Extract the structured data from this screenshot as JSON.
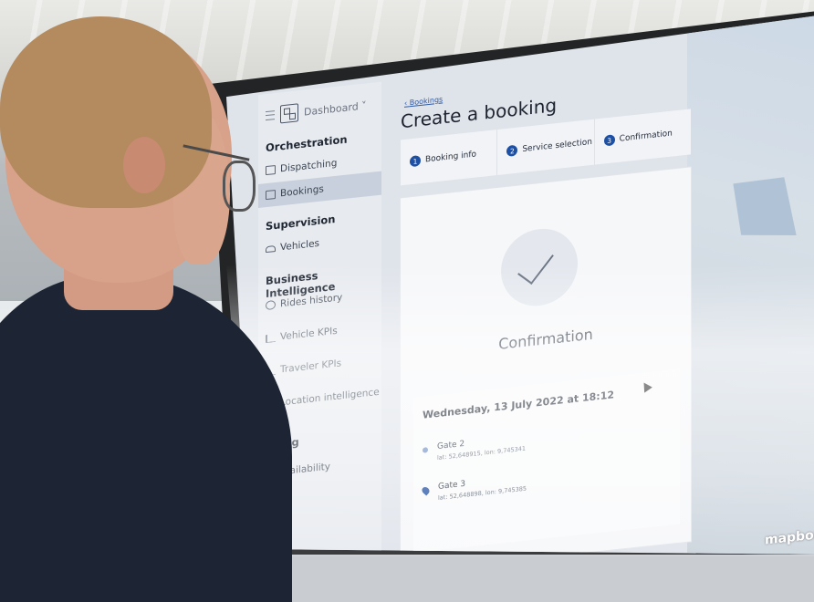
{
  "app": {
    "header": {
      "dashboard_label": "Dashboard ˅"
    },
    "sidebar": {
      "sections": [
        {
          "label": "Orchestration"
        },
        {
          "label": "Supervision"
        },
        {
          "label": "Business Intelligence"
        },
        {
          "label": "nning"
        }
      ],
      "items": [
        {
          "label": "Dispatching",
          "icon": "calendar-icon"
        },
        {
          "label": "Bookings",
          "icon": "booking-icon",
          "active": true
        },
        {
          "label": "Vehicles",
          "icon": "car-icon"
        },
        {
          "label": "Rides history",
          "icon": "history-icon"
        },
        {
          "label": "Vehicle KPIs",
          "icon": "bar-chart-icon"
        },
        {
          "label": "Traveler KPIs",
          "icon": "bar-chart-icon"
        },
        {
          "label": "Location intelligence",
          "icon": "location-icon"
        },
        {
          "label": "et availability",
          "icon": ""
        }
      ]
    },
    "main": {
      "back_link": "Bookings",
      "title": "Create a booking",
      "steps": [
        {
          "num": "1",
          "label": "Booking info"
        },
        {
          "num": "2",
          "label": "Service selection"
        },
        {
          "num": "3",
          "label": "Confirmation"
        }
      ],
      "confirmation": {
        "title": "Confirmation",
        "date": "Wednesday, 13 July 2022 at 18:12",
        "stops": [
          {
            "name": "Gate 2",
            "coords": "lat: 52,648915, lon: 9,745341"
          },
          {
            "name": "Gate 3",
            "coords": "lat: 52,648898, lon: 9,745385"
          }
        ]
      }
    },
    "map": {
      "attribution": "mapbox"
    }
  },
  "colors": {
    "accent": "#1d4fa3",
    "sidebar_bg": "#e7eaef",
    "active_item": "#c7d0dc"
  }
}
